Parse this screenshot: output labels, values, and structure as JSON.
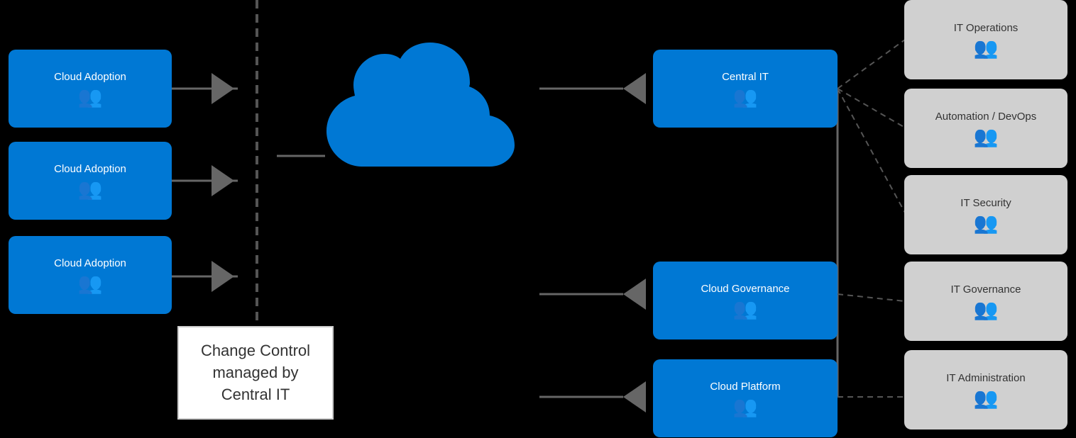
{
  "boxes": {
    "cloud_adoption_1": {
      "label": "Cloud Adoption",
      "type": "blue"
    },
    "cloud_adoption_2": {
      "label": "Cloud Adoption",
      "type": "blue"
    },
    "cloud_adoption_3": {
      "label": "Cloud Adoption",
      "type": "blue"
    },
    "central_it": {
      "label": "Central IT",
      "type": "blue"
    },
    "cloud_governance": {
      "label": "Cloud Governance",
      "type": "blue"
    },
    "cloud_platform": {
      "label": "Cloud Platform",
      "type": "blue"
    },
    "it_operations": {
      "label": "IT Operations",
      "type": "gray"
    },
    "automation_devops": {
      "label": "Automation / DevOps",
      "type": "gray"
    },
    "it_security": {
      "label": "IT Security",
      "type": "gray"
    },
    "it_governance": {
      "label": "IT Governance",
      "type": "gray"
    },
    "it_administration": {
      "label": "IT Administration",
      "type": "gray"
    }
  },
  "change_control": {
    "line1": "Change Control",
    "line2": "managed by",
    "line3": "Central IT"
  },
  "people_icon": "⚇",
  "colors": {
    "blue": "#0078d4",
    "gray_box": "#d0d0d0",
    "arrow": "#666666",
    "dashed": "#555555"
  }
}
